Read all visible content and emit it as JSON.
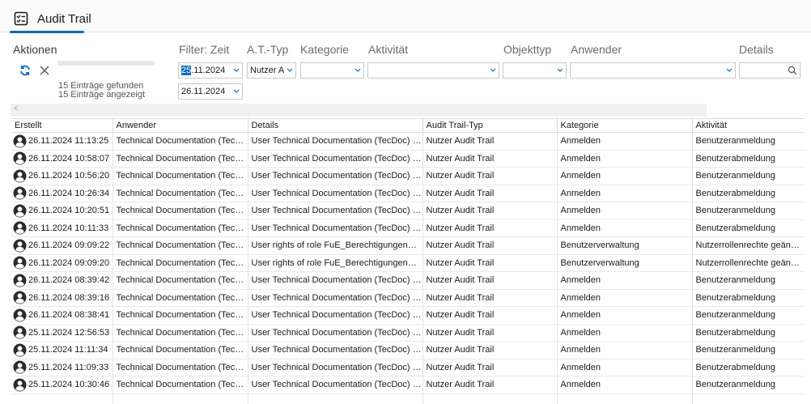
{
  "tab": {
    "title": "Audit Trail"
  },
  "filters": {
    "headers": {
      "aktionen": "Aktionen",
      "filter_zeit": "Filter: Zeit",
      "at_typ": "A.T.-Typ",
      "kategorie": "Kategorie",
      "aktivitaet": "Aktivität",
      "objekttyp": "Objekttyp",
      "anwender": "Anwender",
      "details": "Details"
    },
    "date_from": {
      "selected": "25",
      "rest": ".11.2024"
    },
    "date_to": "26.11.2024",
    "at_typ_value": "Nutzer Au",
    "kategorie_value": "",
    "aktivitaet_value": "",
    "objekttyp_value": "",
    "anwender_value": "",
    "details_value": "",
    "status_found": "15 Einträge gefunden",
    "status_shown": "15 Einträge angezeigt"
  },
  "icons": {
    "tab": "checklist-icon",
    "refresh": "refresh-icon",
    "clear": "close-icon",
    "search": "search-icon",
    "user": "user-icon",
    "caret": "chevron-down-icon",
    "scroll_left": "chevron-left-icon"
  },
  "colors": {
    "accent": "#0f6cbd"
  },
  "table": {
    "columns": [
      "Erstellt",
      "Anwender",
      "Details",
      "Audit Trail-Typ",
      "Kategorie",
      "Aktivität"
    ],
    "rows": [
      [
        "26.11.2024 11:13:25",
        "Technical Documentation (TecDoc)",
        "User Technical Documentation (TecDoc) logg...",
        "Nutzer Audit Trail",
        "Anmelden",
        "Benutzeranmeldung"
      ],
      [
        "26.11.2024 10:58:07",
        "Technical Documentation (TecDoc)",
        "User Technical Documentation (TecDoc) logg...",
        "Nutzer Audit Trail",
        "Anmelden",
        "Benutzerabmeldung"
      ],
      [
        "26.11.2024 10:56:20",
        "Technical Documentation (TecDoc)",
        "User Technical Documentation (TecDoc) logg...",
        "Nutzer Audit Trail",
        "Anmelden",
        "Benutzeranmeldung"
      ],
      [
        "26.11.2024 10:26:34",
        "Technical Documentation (TecDoc)",
        "User Technical Documentation (TecDoc) logg...",
        "Nutzer Audit Trail",
        "Anmelden",
        "Benutzerabmeldung"
      ],
      [
        "26.11.2024 10:20:51",
        "Technical Documentation (TecDoc)",
        "User Technical Documentation (TecDoc) logg...",
        "Nutzer Audit Trail",
        "Anmelden",
        "Benutzeranmeldung"
      ],
      [
        "26.11.2024 10:11:33",
        "Technical Documentation (TecDoc)",
        "User Technical Documentation (TecDoc) logg...",
        "Nutzer Audit Trail",
        "Anmelden",
        "Benutzerabmeldung"
      ],
      [
        "26.11.2024 09:09:22",
        "Technical Documentation (TecDoc)",
        "User rights of role FuE_BerechtigungenSWT c...",
        "Nutzer Audit Trail",
        "Benutzerverwaltung",
        "Nutzerrollenrechte geändert"
      ],
      [
        "26.11.2024 09:09:20",
        "Technical Documentation (TecDoc)",
        "User rights of role FuE_BerechtigungenSWT c...",
        "Nutzer Audit Trail",
        "Benutzerverwaltung",
        "Nutzerrollenrechte geändert"
      ],
      [
        "26.11.2024 08:39:42",
        "Technical Documentation (TecDoc)",
        "User Technical Documentation (TecDoc) logg...",
        "Nutzer Audit Trail",
        "Anmelden",
        "Benutzeranmeldung"
      ],
      [
        "26.11.2024 08:39:16",
        "Technical Documentation (TecDoc)",
        "User Technical Documentation (TecDoc) logg...",
        "Nutzer Audit Trail",
        "Anmelden",
        "Benutzerabmeldung"
      ],
      [
        "26.11.2024 08:38:41",
        "Technical Documentation (TecDoc)",
        "User Technical Documentation (TecDoc) logg...",
        "Nutzer Audit Trail",
        "Anmelden",
        "Benutzeranmeldung"
      ],
      [
        "25.11.2024 12:56:53",
        "Technical Documentation (TecDoc)",
        "User Technical Documentation (TecDoc) logg...",
        "Nutzer Audit Trail",
        "Anmelden",
        "Benutzerabmeldung"
      ],
      [
        "25.11.2024 11:11:34",
        "Technical Documentation (TecDoc)",
        "User Technical Documentation (TecDoc) logg...",
        "Nutzer Audit Trail",
        "Anmelden",
        "Benutzeranmeldung"
      ],
      [
        "25.11.2024 11:09:33",
        "Technical Documentation (TecDoc)",
        "User Technical Documentation (TecDoc) logg...",
        "Nutzer Audit Trail",
        "Anmelden",
        "Benutzerabmeldung"
      ],
      [
        "25.11.2024 10:30:46",
        "Technical Documentation (TecDoc)",
        "User Technical Documentation (TecDoc) logg...",
        "Nutzer Audit Trail",
        "Anmelden",
        "Benutzeranmeldung"
      ]
    ]
  }
}
